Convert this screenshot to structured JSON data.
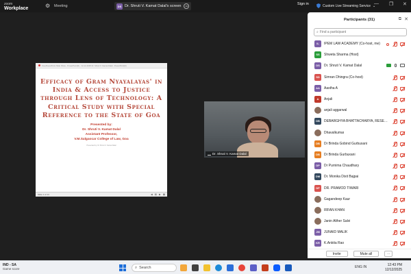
{
  "titlebar": {
    "brand_line1": "zoom",
    "brand_line2": "Workplace",
    "meeting_label": "Meeting",
    "tab_avatar": "DS",
    "tab_label": "Dr. Shruti V. Kamat Dalal's screen",
    "signin_label": "Sign in",
    "stream_label": "Custom Live Streaming Service",
    "stream_chevron": "⌄"
  },
  "slide": {
    "topbar_text": "FreePowerPoint Slide Show - PowerPoint(6) - 12-12-2025 Dr. Shruti V. Kamat Dalal - PowerPoint(6)",
    "title": "Efficacy of Gram Nyayalayas' in India & Access to Justice through Lens of Technology: A Critical Study with Special Reference to the State of Goa",
    "presented_by": "Presented by:",
    "presenter_name": "Dr. Shruti V. Kamat Dalal",
    "presenter_role": "Assistant Professor,",
    "presenter_college": "V.M.Salgaocar College of Law, Goa",
    "footer_text": "Presented by: Dr Shruti V. Kamat Dalal",
    "slide_counter": "Slide 1 of 14"
  },
  "video": {
    "name_label": "Dr. Shruti V. Kamat Dalal"
  },
  "participants_panel": {
    "title": "Participants (31)",
    "search_placeholder": "Find a participant",
    "invite_label": "Invite",
    "mute_all_label": "Mute all",
    "more_label": "...",
    "participants": [
      {
        "initials": "IL",
        "color": "#7b5ea7",
        "name": "IPEM LAW ACADEMY (Co-host, me)",
        "icons": "host"
      },
      {
        "initials": "SS",
        "color": "#2a9d3a",
        "name": "Shweta Sharma (Host)",
        "icons": "none"
      },
      {
        "initials": "DS",
        "color": "#7b5ea7",
        "name": "Dr. Shruti V. Kamat Dalal",
        "icons": "presenter"
      },
      {
        "initials": "SD",
        "color": "#d9534f",
        "name": "Simran Dhingra (Co-host)",
        "icons": "off"
      },
      {
        "initials": "AA",
        "color": "#7b5ea7",
        "name": "Aastha A",
        "icons": "off"
      },
      {
        "initials": "A",
        "color": "#c0392b",
        "name": "Anjali",
        "icons": "off"
      },
      {
        "initials": "",
        "color": "#8a6d5c",
        "name": "anjali aggarwal",
        "icons": "off",
        "photo": true
      },
      {
        "initials": "DB",
        "color": "#34495e",
        "name": "DEBARGHYA BHATTACHARYA, RESEARCH...",
        "icons": "off"
      },
      {
        "initials": "",
        "color": "#8a6d5c",
        "name": "Dhavalkumar",
        "icons": "off",
        "photo": true
      },
      {
        "initials": "DB",
        "color": "#e67e22",
        "name": "Dr Brinda Gobind Gurbuxani",
        "icons": "off"
      },
      {
        "initials": "DB",
        "color": "#e67e22",
        "name": "Dr Brinda Gurbuxani",
        "icons": "off"
      },
      {
        "initials": "DP",
        "color": "#7b5ea7",
        "name": "Dr Purnima Chaudhary",
        "icons": "off"
      },
      {
        "initials": "DM",
        "color": "#34495e",
        "name": "Dr. Monika Dixit Bajpai",
        "icons": "off"
      },
      {
        "initials": "DP",
        "color": "#d9534f",
        "name": "DR. PRAMOD TIWARI",
        "icons": "off"
      },
      {
        "initials": "",
        "color": "#8a6d5c",
        "name": "Gagandeep Kaur",
        "icons": "off",
        "photo": true
      },
      {
        "initials": "",
        "color": "#8a6d5c",
        "name": "IRFAN KHAN",
        "icons": "off",
        "photo": true
      },
      {
        "initials": "",
        "color": "#8a6d5c",
        "name": "Janin Alther Salvi",
        "icons": "off",
        "photo": true
      },
      {
        "initials": "JM",
        "color": "#7b5ea7",
        "name": "JUNAID MALIK",
        "icons": "off"
      },
      {
        "initials": "KR",
        "color": "#7b5ea7",
        "name": "K.Ankita Rao",
        "icons": "off"
      }
    ]
  },
  "taskbar": {
    "lang_line1": "IND - SA",
    "lang_line2": "Game score",
    "search_label": "Search",
    "time": "12:43 PM",
    "date": "12/12/2025",
    "tray_text": "ENG IN"
  }
}
